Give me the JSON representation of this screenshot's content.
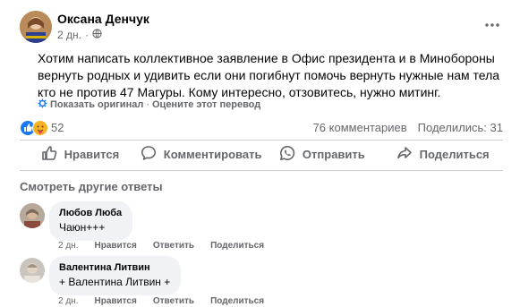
{
  "post": {
    "author": "Оксана Денчук",
    "time": "2 дн.",
    "text": "Хотим написать коллективное заявление в Офис президента и в Минобороны вернуть родных и удивить если они погибнут помочь вернуть нужные нам тела кто не против 47 Магуры. Кому интересно, отзовитесь, нужно митинг.",
    "show_original": "Показать оригинал",
    "separator": "·",
    "rate_translation": "Оцените этот перевод"
  },
  "reactions": {
    "count": "52",
    "comments": "76 комментариев",
    "shares": "Поделились: 31"
  },
  "actions": {
    "like": "Нравится",
    "comment": "Комментировать",
    "send": "Отправить",
    "share": "Поделиться"
  },
  "more_answers": "Смотреть другие ответы",
  "comments": [
    {
      "name": "Любов Люба",
      "text": "Чаюн+++",
      "time": "2 дн.",
      "like": "Нравится",
      "reply": "Ответить",
      "share": "Поделиться"
    },
    {
      "name": "Валентина Литвин",
      "text": "+ Валентина Литвин +",
      "time": "2 дн.",
      "like": "Нравится",
      "reply": "Ответить",
      "share": "Поделиться"
    }
  ],
  "colors": {
    "like_blue": "#1877f2",
    "secondary_text": "#65676b",
    "bubble_bg": "#f0f2f5"
  }
}
